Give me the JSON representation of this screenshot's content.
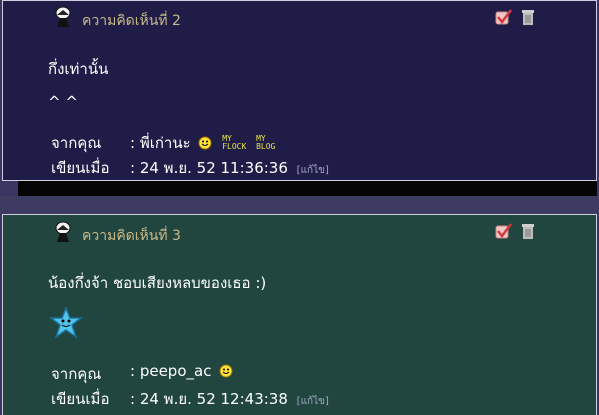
{
  "comments": [
    {
      "title": "ความคิดเห็นที่ 2",
      "message": [
        "กึ่งเท่านั้น",
        "^ ^"
      ],
      "from_label": "จากคุณ",
      "from_value": ": พี่เก่านะ",
      "date_label": "เขียนเมื่อ",
      "date_value": ": 24 พ.ย. 52 11:36:36",
      "edit_label": "[แก้ไข]",
      "badges": [
        "MY",
        "FLOCK",
        "MY",
        "BLOG"
      ]
    },
    {
      "title": "ความคิดเห็นที่ 3",
      "message": [
        "น้องกึ่งจ้า ชอบเสียงหลบของเธอ :)"
      ],
      "from_label": "จากคุณ",
      "from_value": ": peepo_ac",
      "date_label": "เขียนเมื่อ",
      "date_value": ": 24 พ.ย. 52 12:43:38",
      "edit_label": "[แก้ไข]"
    }
  ],
  "colors": {
    "card2_bg": "#1f1d47",
    "card3_bg": "#21463f",
    "title": "#c9b98a",
    "text": "#ffffff"
  },
  "icons": {
    "commenter": "avatar-icon",
    "approve": "check-icon",
    "delete": "trash-icon",
    "smiley": "smiley-icon",
    "star": "star-emoticon-icon"
  }
}
